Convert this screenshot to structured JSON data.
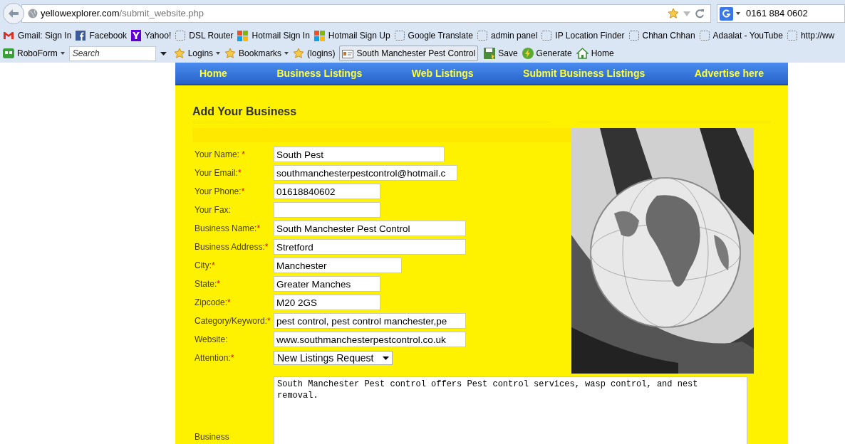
{
  "browser": {
    "url_host": "yellowexplorer.com",
    "url_path": "/submit_website.php",
    "search_value": "0161 884 0602",
    "bookmarks": [
      {
        "label": "Gmail: Sign In",
        "kind": "gmail"
      },
      {
        "label": "Facebook",
        "kind": "facebook"
      },
      {
        "label": "Yahoo!",
        "kind": "yahoo"
      },
      {
        "label": "DSL Router",
        "kind": "blank"
      },
      {
        "label": "Hotmail Sign In",
        "kind": "windows"
      },
      {
        "label": "Hotmail Sign Up",
        "kind": "windows"
      },
      {
        "label": "Google Translate",
        "kind": "blank"
      },
      {
        "label": "admin panel",
        "kind": "blank"
      },
      {
        "label": "IP Location Finder",
        "kind": "blank"
      },
      {
        "label": "Chhan Chhan",
        "kind": "blank"
      },
      {
        "label": "Adaalat - YouTube",
        "kind": "blank"
      },
      {
        "label": "http://ww",
        "kind": "blank"
      }
    ],
    "toolbar": {
      "roboform": "RoboForm",
      "search_placeholder": "Search",
      "logins": "Logins",
      "bookmarks": "Bookmarks",
      "logins_passcard": "(logins)",
      "passcard": "South Manchester Pest Control",
      "save": "Save",
      "generate": "Generate",
      "home": "Home"
    }
  },
  "nav": [
    "Home",
    "Business Listings",
    "Web Listings",
    "Submit Business Listings",
    "Advertise here"
  ],
  "heading": "Add Your Business",
  "fields": [
    {
      "label": "Your Name: ",
      "mark": "*",
      "value": "South Pest",
      "kind": "text"
    },
    {
      "label": "Your Email:",
      "mark": "*",
      "value": "southmanchesterpestcontrol@hotmail.c",
      "kind": "text"
    },
    {
      "label": "Your Phone:",
      "mark": "*",
      "value": "01618840602",
      "kind": "text"
    },
    {
      "label": "Your Fax:",
      "kind": "text"
    },
    {
      "label": "Business Name:",
      "mark": "*",
      "value": "South Manchester Pest Control",
      "kind": "text"
    },
    {
      "label": "Business Address:",
      "mark": "*",
      "value": "Stretford",
      "kind": "text"
    },
    {
      "label": "City:",
      "mark": "*",
      "value": "Manchester",
      "kind": "text"
    },
    {
      "label": "State:",
      "mark": "*",
      "value": "Greater Manches",
      "kind": "text"
    },
    {
      "label": "Zipcode:",
      "mark": "*",
      "value": "M20 2GS",
      "kind": "text"
    },
    {
      "label": "Category/Keyword:",
      "mark": "*",
      "value": "pest control, pest control manchester,pe",
      "kind": "text"
    },
    {
      "label": "Website:",
      "value": "www.southmanchesterpestcontrol.co.uk",
      "kind": "text"
    },
    {
      "label": "Attention:",
      "mark": "*",
      "value": "New Listings Request",
      "kind": "select"
    }
  ],
  "description": {
    "label": "Business",
    "value": "South Manchester Pest control offers Pest control services, wasp control, and nest removal."
  }
}
